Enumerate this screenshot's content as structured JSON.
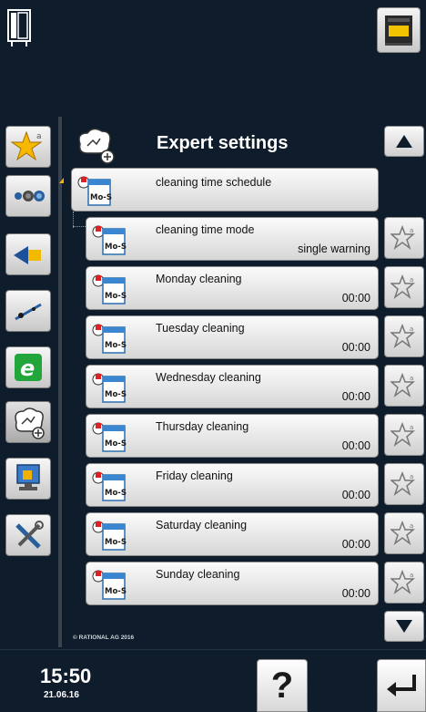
{
  "header": {
    "title": "Expert settings"
  },
  "icons": {
    "device": "combi-steamer-icon",
    "oven": "oven-icon",
    "favorites": "star-favorites-icon",
    "cooking": "cooking-modes-icon",
    "haccp": "haccp-icon",
    "service": "service-icon",
    "efficiency": "efficiency-icon",
    "expert": "expert-settings-icon",
    "network": "network-icon",
    "tools": "tools-icon"
  },
  "rows": [
    {
      "label": "cleaning time schedule",
      "value": "",
      "cal": "Mo-So"
    },
    {
      "label": "cleaning time mode",
      "value": "single warning",
      "cal": "Mo-So"
    },
    {
      "label": "Monday cleaning",
      "value": "00:00",
      "cal": "Mo-So"
    },
    {
      "label": "Tuesday cleaning",
      "value": "00:00",
      "cal": "Mo-So"
    },
    {
      "label": "Wednesday cleaning",
      "value": "00:00",
      "cal": "Mo-So"
    },
    {
      "label": "Thursday cleaning",
      "value": "00:00",
      "cal": "Mo-So"
    },
    {
      "label": "Friday cleaning",
      "value": "00:00",
      "cal": "Mo-So"
    },
    {
      "label": "Saturday cleaning",
      "value": "00:00",
      "cal": "Mo-So"
    },
    {
      "label": "Sunday cleaning",
      "value": "00:00",
      "cal": "Mo-So"
    }
  ],
  "footer": {
    "copyright": "© RATIONAL AG 2016",
    "time": "15:50",
    "date": "21.06.16",
    "help_label": "?"
  },
  "colors": {
    "accent": "#f5b400",
    "background": "#0e1c2b",
    "button": "#e6e6e6"
  }
}
